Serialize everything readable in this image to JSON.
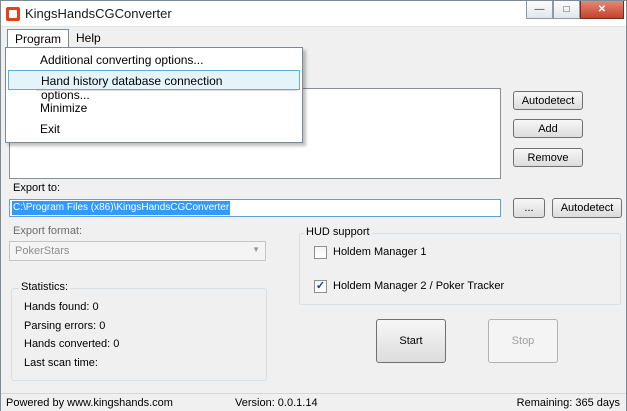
{
  "window": {
    "title": "KingsHandsCGConverter",
    "controls": {
      "minimize": "—",
      "maximize": "□",
      "close": "✕"
    }
  },
  "menubar": {
    "items": [
      {
        "label": "Program",
        "active": true
      },
      {
        "label": "Help",
        "active": false
      }
    ]
  },
  "program_menu": {
    "items": [
      {
        "label": "Additional converting options..."
      },
      {
        "label": "Hand history database connection options...",
        "highlighted": true
      },
      {
        "label": "Minimize"
      },
      {
        "label": "Exit"
      }
    ]
  },
  "folders": {
    "autodetect_label": "Autodetect",
    "add_label": "Add",
    "remove_label": "Remove"
  },
  "export_to": {
    "label": "Export to:",
    "value": "C:\\Program Files (x86)\\KingsHandsCGConverter",
    "browse_label": "...",
    "autodetect_label": "Autodetect"
  },
  "export_format": {
    "label": "Export format:",
    "selected": "PokerStars"
  },
  "hud_support": {
    "title": "HUD support",
    "options": [
      {
        "label": "Holdem Manager 1",
        "checked": false
      },
      {
        "label": "Holdem Manager 2 / Poker Tracker",
        "checked": true
      }
    ]
  },
  "statistics": {
    "title": "Statistics:",
    "hands_found_label": "Hands found:",
    "hands_found": "0",
    "parsing_errors_label": "Parsing errors:",
    "parsing_errors": "0",
    "hands_converted_label": "Hands converted:",
    "hands_converted": "0",
    "last_scan_label": "Last scan time:",
    "last_scan": ""
  },
  "actions": {
    "start_label": "Start",
    "stop_label": "Stop"
  },
  "statusbar": {
    "powered_by": "Powered by www.kingshands.com",
    "version": "Version: 0.0.1.14",
    "remaining": "Remaining: 365 days"
  }
}
